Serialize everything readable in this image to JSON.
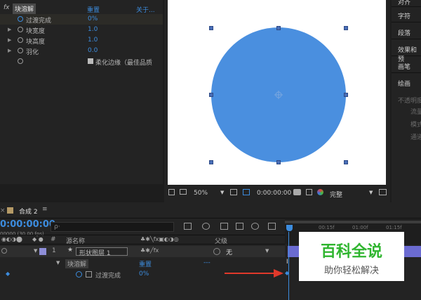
{
  "effect_controls": {
    "fx_label": "fx",
    "effect_name": "块溶解",
    "reset_label": "重置",
    "about_label": "关于...",
    "properties": [
      {
        "label": "过渡完成",
        "value": "0%"
      },
      {
        "label": "块宽度",
        "value": "1.0"
      },
      {
        "label": "块高度",
        "value": "1.0"
      },
      {
        "label": "羽化",
        "value": "0.0"
      }
    ],
    "soften_edges_label": "柔化边缘（最佳品质"
  },
  "viewer": {
    "zoom": "50%",
    "timecode": "0:00:00:00",
    "resolution": "完整",
    "shape_color": "#4a8fdf"
  },
  "right_panel": {
    "items": [
      "对齐",
      "字符",
      "段落",
      "效果和预",
      "画笔",
      "绘画"
    ],
    "opacity_label": "不透明度",
    "flow_label": "流量",
    "mode_label": "模式",
    "channel_label": "通道"
  },
  "timeline": {
    "comp_name": "合成 2",
    "timecode": "0:00:00:00",
    "fps": "00000 (30.00 fps)",
    "search_placeholder": "ρ·",
    "hash_header": "#",
    "source_name_header": "源名称",
    "parent_header": "父级",
    "layer_number": "1",
    "layer_name": "形状图层 1",
    "parent_value": "无",
    "effect_name": "块溶解",
    "reset_label": "重置",
    "dots_label": "---",
    "property_label": "过渡完成",
    "property_value": "0%",
    "ruler_marks": [
      "00:15f",
      "01:00f",
      "01:15f"
    ]
  },
  "watermark": {
    "title": "百科全说",
    "subtitle": "助你轻松解决"
  }
}
